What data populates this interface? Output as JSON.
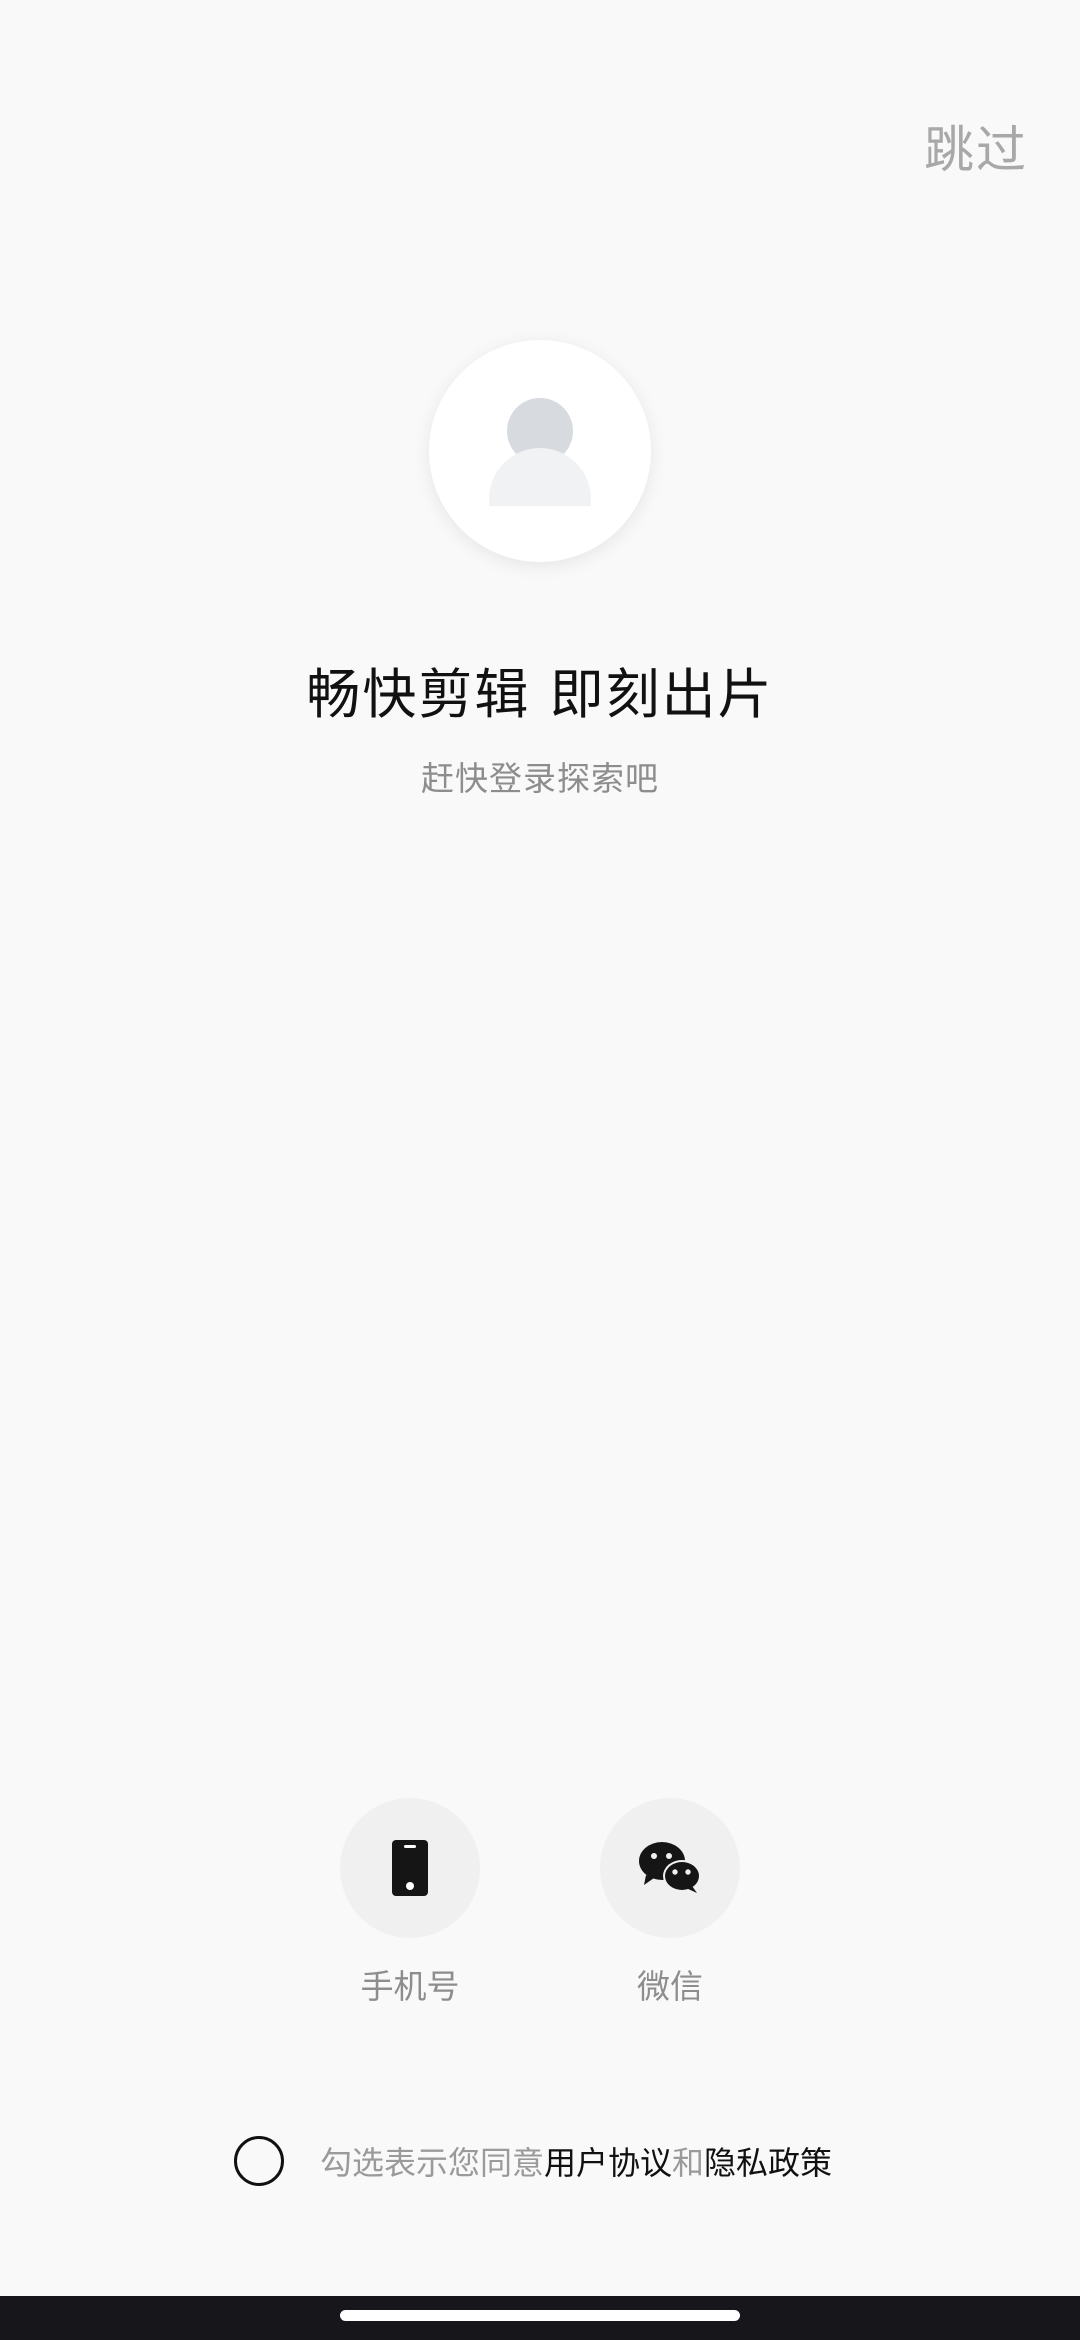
{
  "header": {
    "skip_label": "跳过"
  },
  "hero": {
    "avatar_icon": "user-avatar-placeholder",
    "headline": "畅快剪辑 即刻出片",
    "subline": "赶快登录探索吧"
  },
  "login_options": [
    {
      "label": "手机号",
      "icon": "phone-icon"
    },
    {
      "label": "微信",
      "icon": "wechat-icon"
    }
  ],
  "agreement": {
    "prefix": "勾选表示您同意",
    "user_agreement": "用户协议",
    "conjunction": "和",
    "privacy_policy": "隐私政策"
  },
  "colors": {
    "background": "#f9f9f9",
    "primary_text": "#111111",
    "secondary_text": "#8d8d8d",
    "skip_text": "#a8a8a8",
    "option_bg": "#f0f0f0"
  }
}
